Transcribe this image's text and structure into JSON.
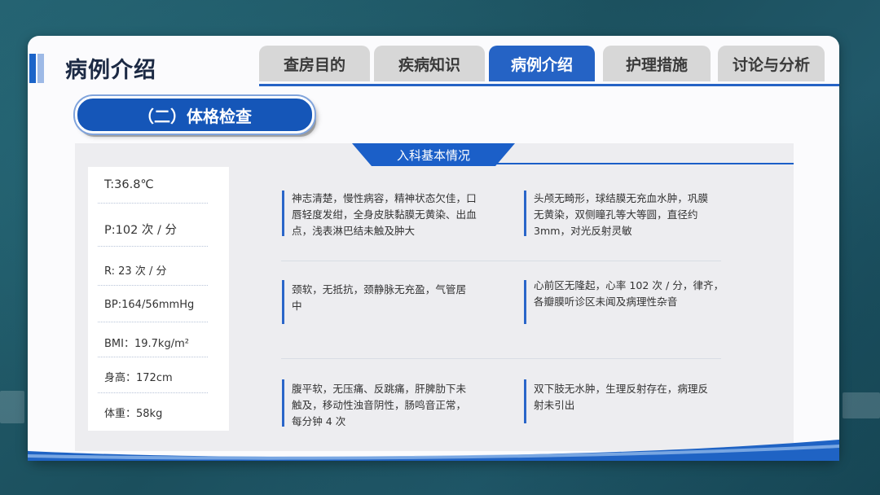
{
  "header": {
    "title": "病例介绍",
    "tabs": [
      {
        "label": "查房目的",
        "active": false
      },
      {
        "label": "疾病知识",
        "active": false
      },
      {
        "label": "病例介绍",
        "active": true
      },
      {
        "label": "护理措施",
        "active": false
      },
      {
        "label": "讨论与分析",
        "active": false
      }
    ]
  },
  "section": {
    "title": "（二）体格检查",
    "banner": "入科基本情况"
  },
  "vitals": [
    "T:36.8℃",
    "P:102 次 / 分",
    "R:  23 次 / 分",
    "BP:164/56mmHg",
    "BMI：19.7kg/m²",
    "身高：172cm",
    "体重：58kg"
  ],
  "findings": {
    "row1_left": "神志清楚，慢性病容，精神状态欠佳，口唇轻度发绀，全身皮肤黏膜无黄染、出血点，浅表淋巴结未触及肿大",
    "row1_right": "头颅无畸形，球结膜无充血水肿，巩膜无黄染，双侧瞳孔等大等圆，直径约 3mm，对光反射灵敏",
    "row2_left": "颈软，无抵抗，颈静脉无充盈，气管居中",
    "row2_right": "心前区无隆起，心率 102 次 / 分，律齐，各瓣膜听诊区未闻及病理性杂音",
    "row3_left": "腹平软，无压痛、反跳痛，肝脾肋下未触及，移动性浊音阴性，肠鸣音正常，每分钟 4 次",
    "row3_right": "双下肢无水肿，生理反射存在，病理反射未引出"
  },
  "colors": {
    "accent": "#2563c5",
    "tab_inactive": "#d7d7d7",
    "background": "#1f5866"
  }
}
